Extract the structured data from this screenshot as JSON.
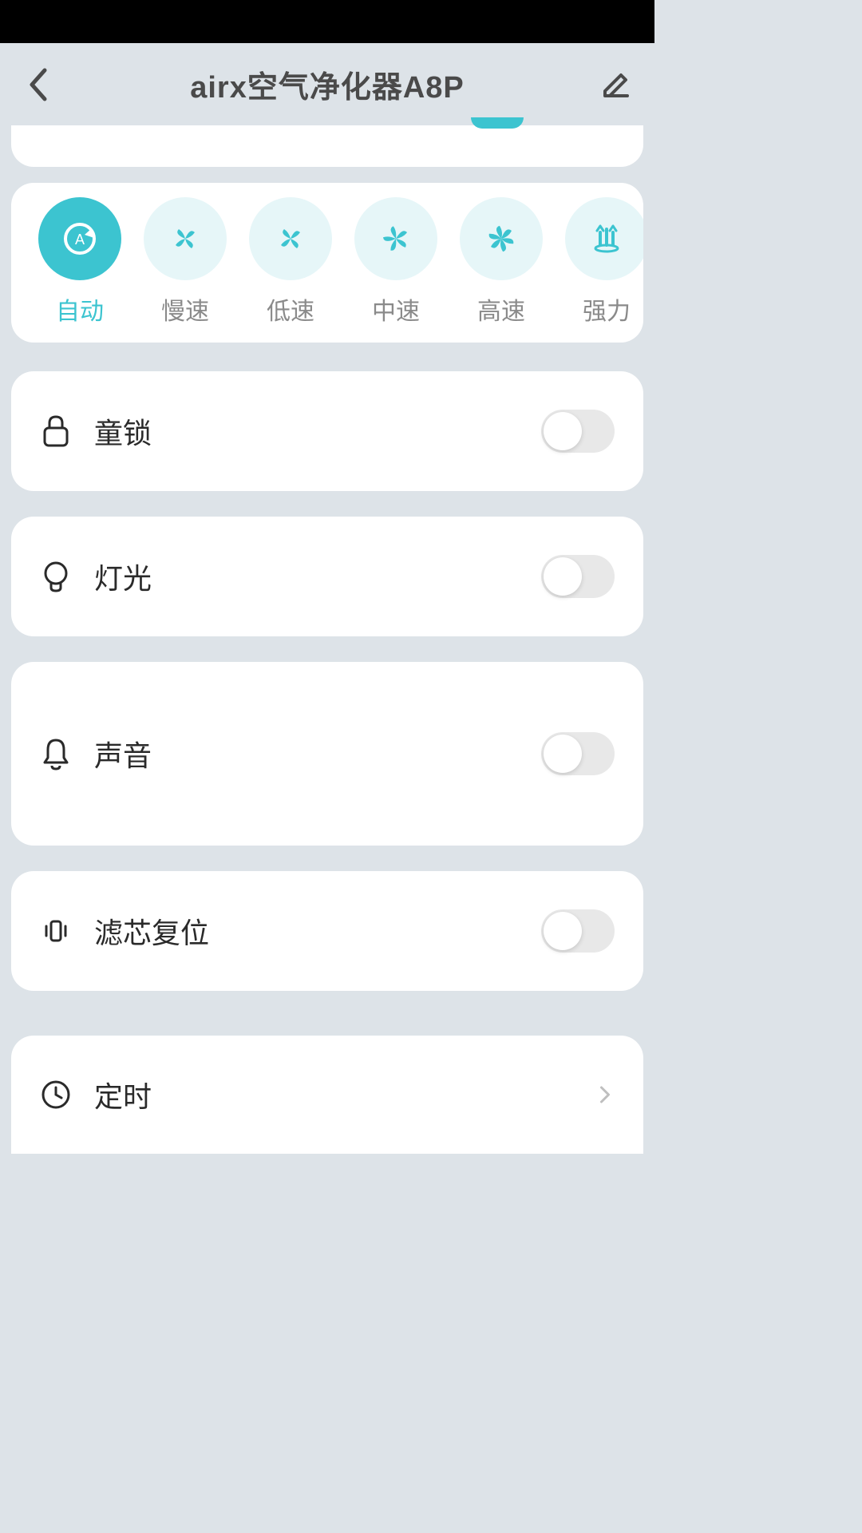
{
  "header": {
    "title": "airx空气净化器A8P"
  },
  "modes": [
    {
      "label": "自动",
      "icon": "auto",
      "active": true
    },
    {
      "label": "慢速",
      "icon": "fan-slow",
      "active": false
    },
    {
      "label": "低速",
      "icon": "fan-low",
      "active": false
    },
    {
      "label": "中速",
      "icon": "fan-mid",
      "active": false
    },
    {
      "label": "高速",
      "icon": "fan-high",
      "active": false
    },
    {
      "label": "强力",
      "icon": "power",
      "active": false
    }
  ],
  "settings": {
    "childlock": {
      "label": "童锁",
      "on": false
    },
    "light": {
      "label": "灯光",
      "on": false
    },
    "sound": {
      "label": "声音",
      "on": false
    },
    "filter": {
      "label": "滤芯复位",
      "on": false
    },
    "timer": {
      "label": "定时"
    }
  }
}
